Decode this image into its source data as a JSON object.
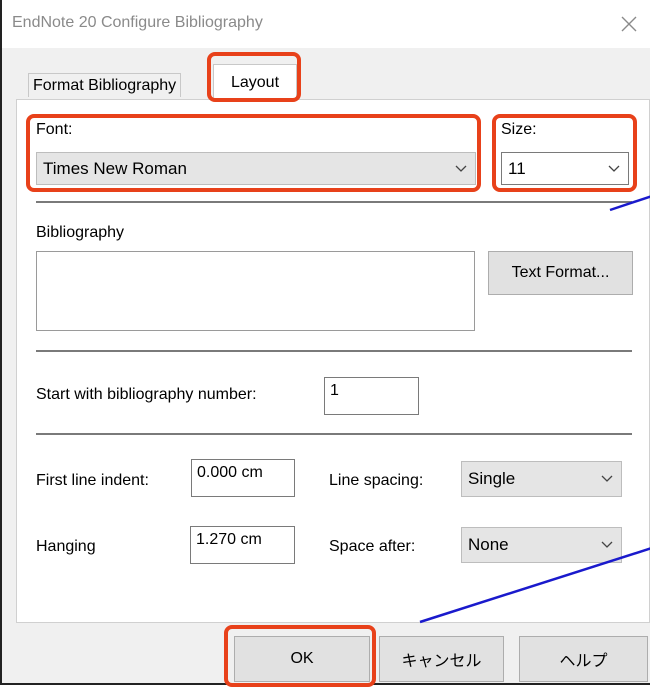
{
  "window": {
    "title": "EndNote 20 Configure Bibliography"
  },
  "tabs": [
    {
      "label": "Format Bibliography"
    },
    {
      "label": "Layout"
    }
  ],
  "font": {
    "label": "Font:",
    "value": "Times New Roman"
  },
  "size": {
    "label": "Size:",
    "value": "11"
  },
  "bibliography": {
    "label": "Bibliography",
    "text_format_button": "Text Format..."
  },
  "start_number": {
    "label": "Start with bibliography number:",
    "value": "1"
  },
  "first_line_indent": {
    "label": "First line indent:",
    "value": "0.000 cm"
  },
  "line_spacing": {
    "label": "Line spacing:",
    "value": "Single"
  },
  "hanging": {
    "label": "Hanging",
    "value": "1.270 cm"
  },
  "space_after": {
    "label": "Space after:",
    "value": "None"
  },
  "buttons": {
    "ok": "OK",
    "cancel": "キャンセル",
    "help": "ヘルプ"
  },
  "colors": {
    "highlight": "#e8411a",
    "pointer_line": "#1a1acc"
  }
}
